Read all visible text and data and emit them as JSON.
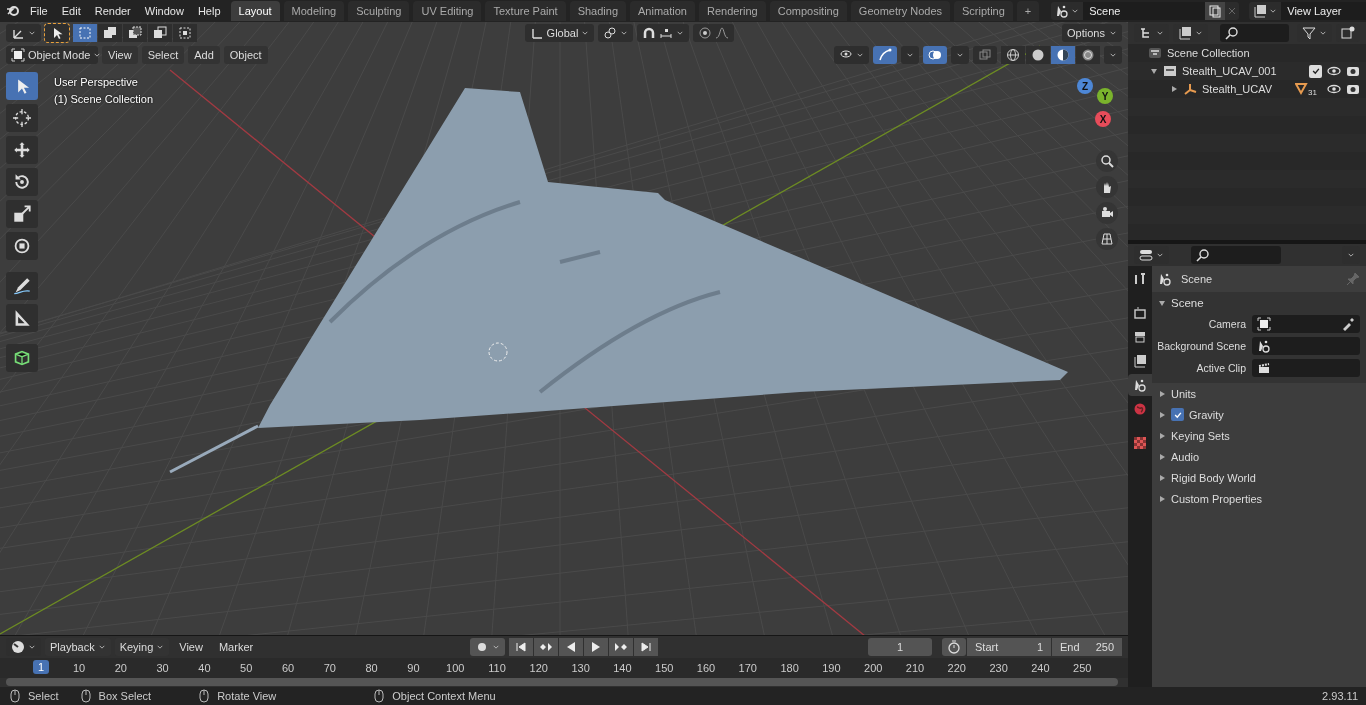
{
  "menu": [
    "File",
    "Edit",
    "Render",
    "Window",
    "Help"
  ],
  "workspace_tabs": [
    {
      "label": "Layout",
      "selected": true
    },
    {
      "label": "Modeling",
      "selected": false
    },
    {
      "label": "Sculpting",
      "selected": false
    },
    {
      "label": "UV Editing",
      "selected": false
    },
    {
      "label": "Texture Paint",
      "selected": false
    },
    {
      "label": "Shading",
      "selected": false
    },
    {
      "label": "Animation",
      "selected": false
    },
    {
      "label": "Rendering",
      "selected": false
    },
    {
      "label": "Compositing",
      "selected": false
    },
    {
      "label": "Geometry Nodes",
      "selected": false
    },
    {
      "label": "Scripting",
      "selected": false
    }
  ],
  "add_tab": "+",
  "scene_field": "Scene",
  "view_layer_field": "View Layer",
  "viewport": {
    "mode": "Object Mode",
    "menus": [
      "View",
      "Select",
      "Add",
      "Object"
    ],
    "orientation": "Global",
    "options": "Options",
    "overlay_lines": [
      "User Perspective",
      "(1) Scene Collection"
    ],
    "select_modes": [
      {
        "kind": "set",
        "selected": true
      },
      {
        "kind": "extend",
        "selected": false
      },
      {
        "kind": "subtract",
        "selected": false
      },
      {
        "kind": "invert",
        "selected": false
      },
      {
        "kind": "intersect",
        "selected": false
      }
    ],
    "tools": [
      {
        "kind": "select",
        "selected": true
      },
      {
        "kind": "cursor",
        "selected": false
      },
      {
        "kind": "move",
        "selected": false
      },
      {
        "kind": "rotate",
        "selected": false
      },
      {
        "kind": "scale",
        "selected": false
      },
      {
        "kind": "transform",
        "selected": false
      },
      {
        "kind": "annotate",
        "selected": false
      },
      {
        "kind": "measure",
        "selected": false
      },
      {
        "kind": "add-cube",
        "selected": false
      }
    ],
    "shading": [
      {
        "kind": "wireframe",
        "selected": false
      },
      {
        "kind": "solid",
        "selected": false
      },
      {
        "kind": "material",
        "selected": true
      },
      {
        "kind": "rendered",
        "selected": false
      }
    ],
    "axes": [
      "X",
      "Y",
      "Z"
    ]
  },
  "outliner": {
    "root": "Scene Collection",
    "items": [
      {
        "label": "Stealth_UCAV_001",
        "kind": "collection",
        "expanded": true,
        "checked": true,
        "children": [
          {
            "label": "Stealth_UCAV",
            "kind": "empty",
            "expanded": false,
            "badge": "31"
          }
        ]
      }
    ]
  },
  "properties": {
    "tabs": [
      {
        "kind": "tool",
        "selected": false
      },
      {
        "kind": "render",
        "selected": false
      },
      {
        "kind": "output",
        "selected": false
      },
      {
        "kind": "view-layer",
        "selected": false
      },
      {
        "kind": "scene",
        "selected": true
      },
      {
        "kind": "world",
        "selected": false
      },
      {
        "kind": "texture",
        "selected": false
      }
    ],
    "context": "Scene",
    "panel": {
      "title": "Scene",
      "expanded": true,
      "fields": [
        {
          "label": "Camera",
          "kind": "camera"
        },
        {
          "label": "Background Scene",
          "kind": "scene"
        },
        {
          "label": "Active Clip",
          "kind": "clip"
        }
      ]
    },
    "sections": [
      {
        "label": "Units",
        "expanded": false
      },
      {
        "label": "Gravity",
        "expanded": false,
        "checked": true
      },
      {
        "label": "Keying Sets",
        "expanded": false
      },
      {
        "label": "Audio",
        "expanded": false
      },
      {
        "label": "Rigid Body World",
        "expanded": false
      },
      {
        "label": "Custom Properties",
        "expanded": false
      }
    ]
  },
  "timeline": {
    "menus": [
      "Playback",
      "Keying",
      "View",
      "Marker"
    ],
    "current_frame": "1",
    "start_label": "Start",
    "start": "1",
    "end_label": "End",
    "end": "250",
    "playhead": "1",
    "ticks": [
      "10",
      "20",
      "30",
      "40",
      "50",
      "60",
      "70",
      "80",
      "90",
      "100",
      "110",
      "120",
      "130",
      "140",
      "150",
      "160",
      "170",
      "180",
      "190",
      "200",
      "210",
      "220",
      "230",
      "240",
      "250"
    ]
  },
  "status": [
    "Select",
    "Box Select",
    "Rotate View",
    "Object Context Menu"
  ],
  "version": "2.93.11"
}
